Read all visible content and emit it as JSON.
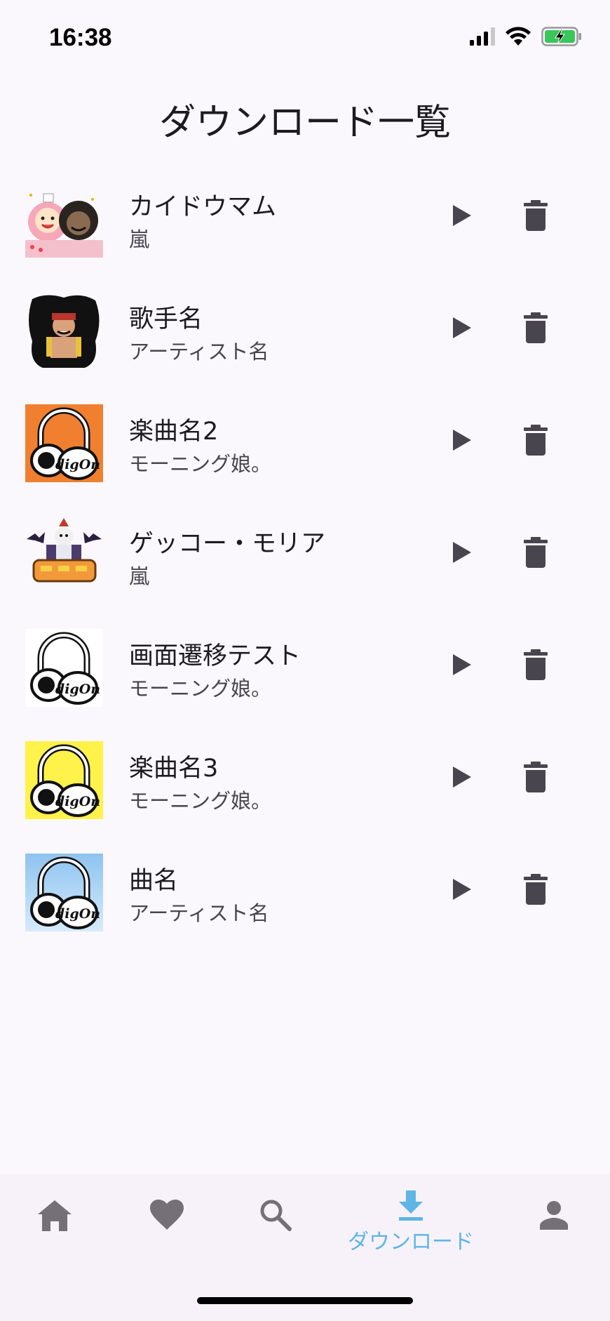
{
  "status_bar": {
    "time": "16:38"
  },
  "header": {
    "title": "ダウンロード一覧"
  },
  "songs": [
    {
      "title": "カイドウマム",
      "artist": "嵐",
      "thumb": "anime-pair"
    },
    {
      "title": "歌手名",
      "artist": "アーティスト名",
      "thumb": "anime-dark"
    },
    {
      "title": "楽曲名2",
      "artist": "モーニング娘。",
      "thumb": "digon-orange"
    },
    {
      "title": "ゲッコー・モリア",
      "artist": "嵐",
      "thumb": "anime-bats"
    },
    {
      "title": "画面遷移テスト",
      "artist": "モーニング娘。",
      "thumb": "digon-white"
    },
    {
      "title": "楽曲名3",
      "artist": "モーニング娘。",
      "thumb": "digon-yellow"
    },
    {
      "title": "曲名",
      "artist": "アーティスト名",
      "thumb": "digon-blue"
    }
  ],
  "bottom_nav": {
    "active": "download",
    "items": [
      {
        "id": "home",
        "icon": "home-icon",
        "label": ""
      },
      {
        "id": "favorites",
        "icon": "heart-icon",
        "label": ""
      },
      {
        "id": "search",
        "icon": "search-icon",
        "label": ""
      },
      {
        "id": "download",
        "icon": "download-icon",
        "label": "ダウンロード"
      },
      {
        "id": "account",
        "icon": "person-icon",
        "label": ""
      }
    ]
  },
  "colors": {
    "background": "#fbf8fd",
    "nav_background": "#f7f2fa",
    "active": "#5fb5e6",
    "icon": "#49454f",
    "digon_orange": "#f08030",
    "digon_yellow": "#fff24a",
    "digon_blue_top": "#8ec3f0",
    "digon_blue_bottom": "#d6ebfb"
  }
}
